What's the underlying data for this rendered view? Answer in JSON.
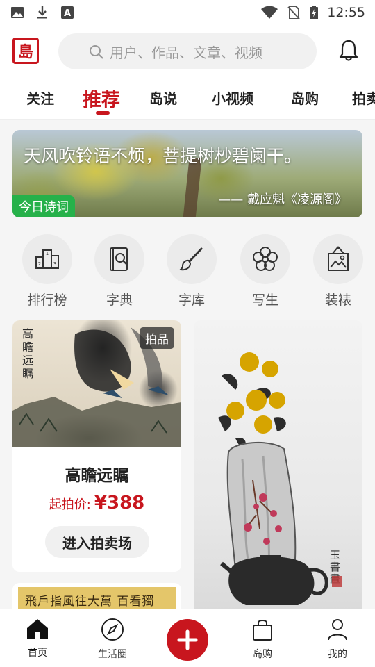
{
  "status_bar": {
    "time": "12:55"
  },
  "header": {
    "logo_text": "島",
    "search_placeholder": "用户、作品、文章、视频"
  },
  "tabs": [
    {
      "label": "关注"
    },
    {
      "label": "推荐",
      "active": true
    },
    {
      "label": "岛说"
    },
    {
      "label": "小视频"
    },
    {
      "label": "岛购"
    },
    {
      "label": "拍卖"
    }
  ],
  "banner": {
    "poem": "天风吹铃语不烦，菩提树杪碧阑干。",
    "author": "—— 戴应魁《凌源阁》",
    "tag": "今日诗词"
  },
  "quick_menu": [
    {
      "label": "排行榜",
      "icon": "podium-icon"
    },
    {
      "label": "字典",
      "icon": "dictionary-icon"
    },
    {
      "label": "字库",
      "icon": "brush-icon"
    },
    {
      "label": "写生",
      "icon": "flower-icon"
    },
    {
      "label": "装裱",
      "icon": "frame-icon"
    }
  ],
  "feed": {
    "card1": {
      "calligraphy": "高瞻远瞩",
      "badge": "拍品",
      "title": "高瞻远瞩",
      "price_label": "起拍价:",
      "price_value": "¥388",
      "button": "进入拍卖场"
    },
    "card2": {
      "strip_text": "飛戶指風往大萬 百看獨"
    },
    "card3": {
      "calligraphy": "玉書畫"
    }
  },
  "bottom_nav": [
    {
      "label": "首页",
      "icon": "home-icon",
      "active": true
    },
    {
      "label": "生活圈",
      "icon": "compass-icon"
    },
    {
      "label": "",
      "icon": "plus-icon"
    },
    {
      "label": "岛购",
      "icon": "shopping-bag-icon"
    },
    {
      "label": "我的",
      "icon": "user-icon"
    }
  ],
  "colors": {
    "brand_red": "#c8161e",
    "tag_green": "#26b14a"
  }
}
